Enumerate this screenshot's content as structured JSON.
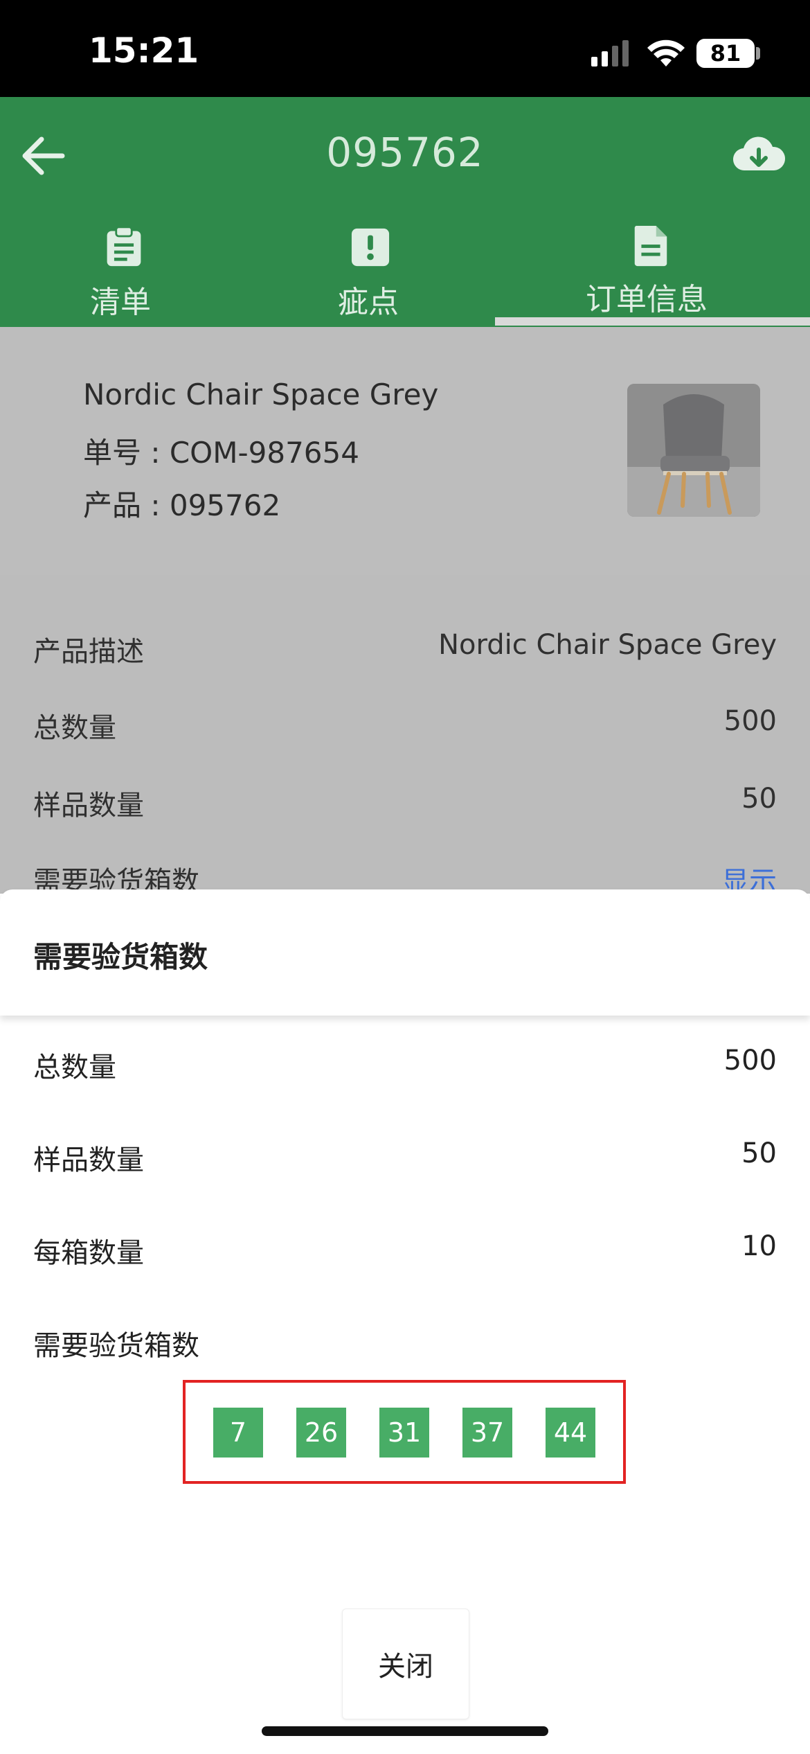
{
  "status_bar": {
    "time": "15:21",
    "battery": "81"
  },
  "header": {
    "title": "095762"
  },
  "tabs": [
    {
      "label": "清单",
      "icon": "clipboard-icon"
    },
    {
      "label": "疵点",
      "icon": "alert-icon"
    },
    {
      "label": "订单信息",
      "icon": "document-icon"
    }
  ],
  "product": {
    "name": "Nordic Chair Space Grey",
    "order_no": "单号 : COM-987654",
    "product_no": "产品 : 095762"
  },
  "info": [
    {
      "label": "产品描述",
      "value": "Nordic Chair Space Grey"
    },
    {
      "label": "总数量",
      "value": "500"
    },
    {
      "label": "样品数量",
      "value": "50"
    },
    {
      "label": "需要验货箱数",
      "value": "显示"
    }
  ],
  "sheet": {
    "title": "需要验货箱数",
    "rows": [
      {
        "label": "总数量",
        "value": "500"
      },
      {
        "label": "样品数量",
        "value": "50"
      },
      {
        "label": "每箱数量",
        "value": "10"
      }
    ],
    "boxes_label": "需要验货箱数",
    "boxes": [
      "7",
      "26",
      "31",
      "37",
      "44"
    ],
    "close_label": "关闭"
  },
  "colors": {
    "header_green": "#2f8a4b",
    "chip_green": "#48ad66",
    "highlight_red": "#e22323",
    "link_blue": "#3c6fd8"
  }
}
